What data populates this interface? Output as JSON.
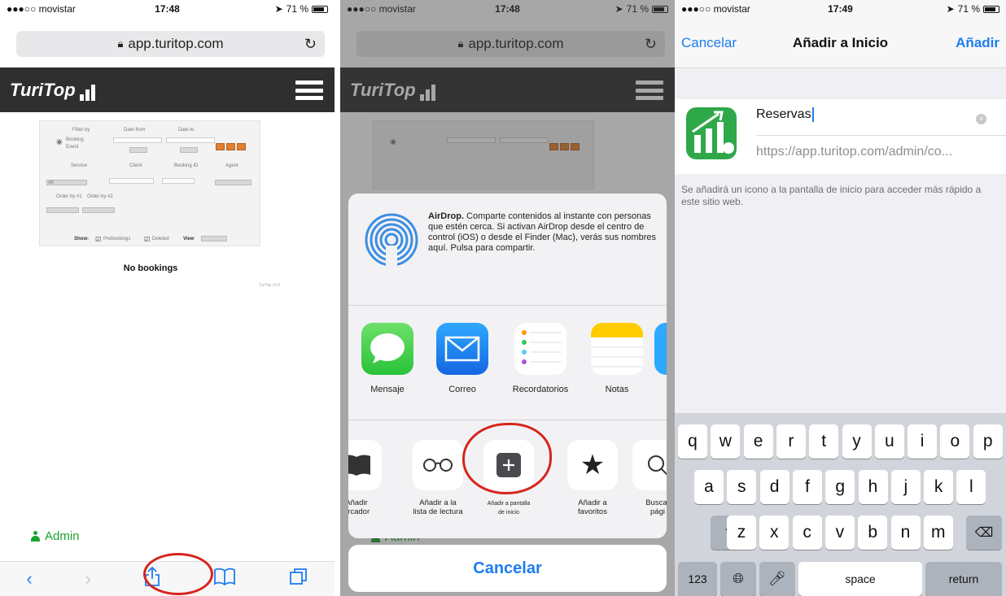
{
  "status": {
    "carrier": "●●●○○ movistar",
    "time_a": "17:48",
    "time_b": "17:48",
    "time_c": "17:49",
    "battery": "71 %"
  },
  "browser": {
    "url": "app.turitop.com",
    "lock_icon": "lock-icon",
    "reload_icon": "reload-icon"
  },
  "site": {
    "logo_text": "TuriTop",
    "filter": {
      "filter_by": "Filter by",
      "date_from": "Date from",
      "date_to": "Date to",
      "booking": "Booking",
      "event": "Event",
      "service": "Service",
      "client": "Client",
      "booking_id": "Booking ID",
      "agent": "Agent",
      "all": "All",
      "order_by_1": "Order by #1",
      "order_by_2": "Order by #2",
      "show": "Show:",
      "prebookings": "Prebookings",
      "deleted": "Deleted",
      "view": "View"
    },
    "no_bookings": "No bookings",
    "powered_by": "TurTop v0.5",
    "admin_link": "Admin"
  },
  "share_sheet": {
    "airdrop_title": "AirDrop.",
    "airdrop_text": " Comparte contenidos al instante con personas que estén cerca. Si activan AirDrop desde el centro de control (iOS) o desde el Finder (Mac), verás sus nombres aquí. Pulsa para compartir.",
    "apps": [
      {
        "label": "Mensaje"
      },
      {
        "label": "Correo"
      },
      {
        "label": "Recordatorios"
      },
      {
        "label": "Notas"
      }
    ],
    "actions": [
      {
        "label": "Añadir\narcador"
      },
      {
        "label": "Añadir a la\nlista de lectura"
      },
      {
        "label": "Añadir a pantalla\nde inicio"
      },
      {
        "label": "Añadir a\nfavoritos"
      },
      {
        "label": "Buscar\npági"
      }
    ],
    "behind_text": "Admin",
    "cancel": "Cancelar"
  },
  "add_home": {
    "cancel": "Cancelar",
    "title": "Añadir a Inicio",
    "add": "Añadir",
    "name_value": "Reservas",
    "url_value": "https://app.turitop.com/admin/co...",
    "hint": "Se añadirá un icono a la pantalla de inicio para acceder más rápido a este sitio web."
  },
  "keyboard": {
    "row1": [
      "q",
      "w",
      "e",
      "r",
      "t",
      "y",
      "u",
      "i",
      "o",
      "p"
    ],
    "row2": [
      "a",
      "s",
      "d",
      "f",
      "g",
      "h",
      "j",
      "k",
      "l"
    ],
    "row3": [
      "z",
      "x",
      "c",
      "v",
      "b",
      "n",
      "m"
    ],
    "numbers": "123",
    "space": "space",
    "return": "return"
  },
  "colors": {
    "accent": "#1e7cf2",
    "header": "#2f2f2f",
    "admin_green": "#1aa332",
    "annotation_red": "#d8251c"
  }
}
